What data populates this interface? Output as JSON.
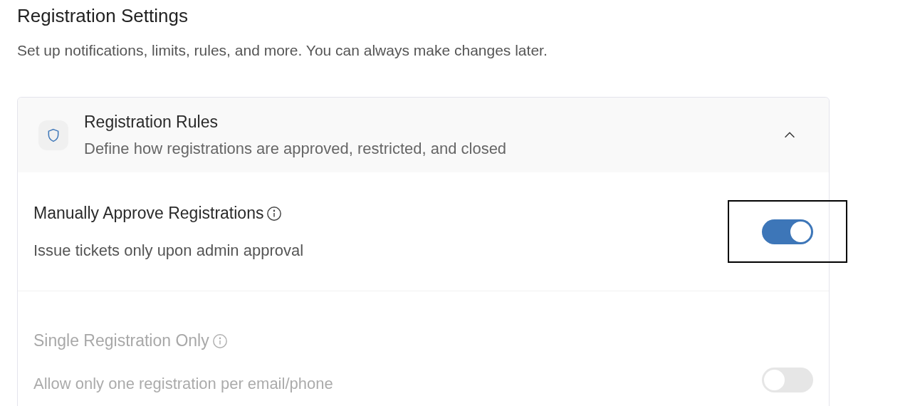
{
  "page": {
    "title": "Registration Settings",
    "subtitle": "Set up notifications, limits, rules, and more. You can always make changes later."
  },
  "section": {
    "title": "Registration Rules",
    "description": "Define how registrations are approved, restricted, and closed",
    "expanded": true,
    "settings": [
      {
        "title": "Manually Approve Registrations",
        "description": "Issue tickets only upon admin approval",
        "on": true,
        "disabled": false,
        "highlighted": true
      },
      {
        "title": "Single Registration Only",
        "description": "Allow only one registration per email/phone",
        "on": false,
        "disabled": true,
        "highlighted": false
      }
    ]
  }
}
